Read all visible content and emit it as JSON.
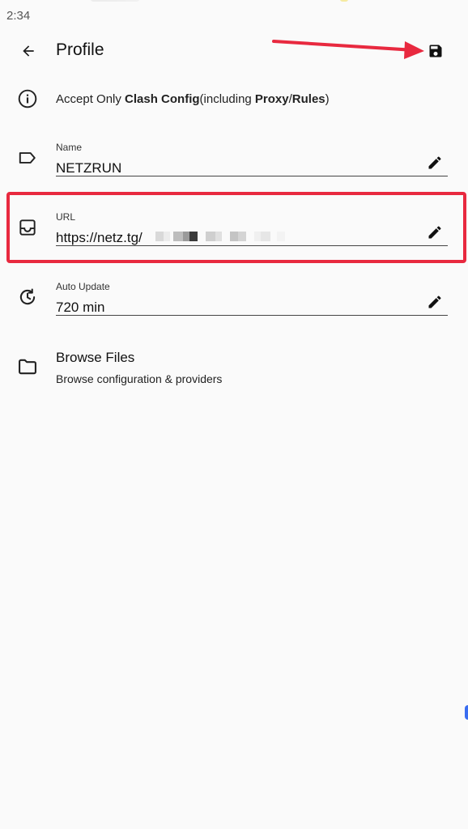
{
  "status_bar": {
    "time": "2:34"
  },
  "app_bar": {
    "title": "Profile",
    "back_icon": "arrow-left-icon",
    "save_icon": "floppy-disk-icon"
  },
  "info": {
    "text_prefix": "Accept Only ",
    "bold_1": "Clash Config",
    "text_mid": "(including ",
    "bold_2": "Proxy",
    "slash": "/",
    "bold_3": "Rules",
    "text_suffix": ")"
  },
  "fields": {
    "name": {
      "label": "Name",
      "value": "NETZRUN",
      "icon": "label-tag-icon",
      "edit_icon": "pencil-icon"
    },
    "url": {
      "label": "URL",
      "value": "https://netz.tg/",
      "icon": "inbox-tray-icon",
      "edit_icon": "pencil-icon"
    },
    "auto_update": {
      "label": "Auto Update",
      "value": "720 min",
      "icon": "clock-update-icon",
      "edit_icon": "pencil-icon"
    }
  },
  "browse": {
    "title": "Browse Files",
    "subtitle": "Browse configuration & providers",
    "icon": "folder-icon"
  },
  "colors": {
    "background": "#fafafa",
    "annotation_red": "#e8293f",
    "text": "#111111"
  }
}
